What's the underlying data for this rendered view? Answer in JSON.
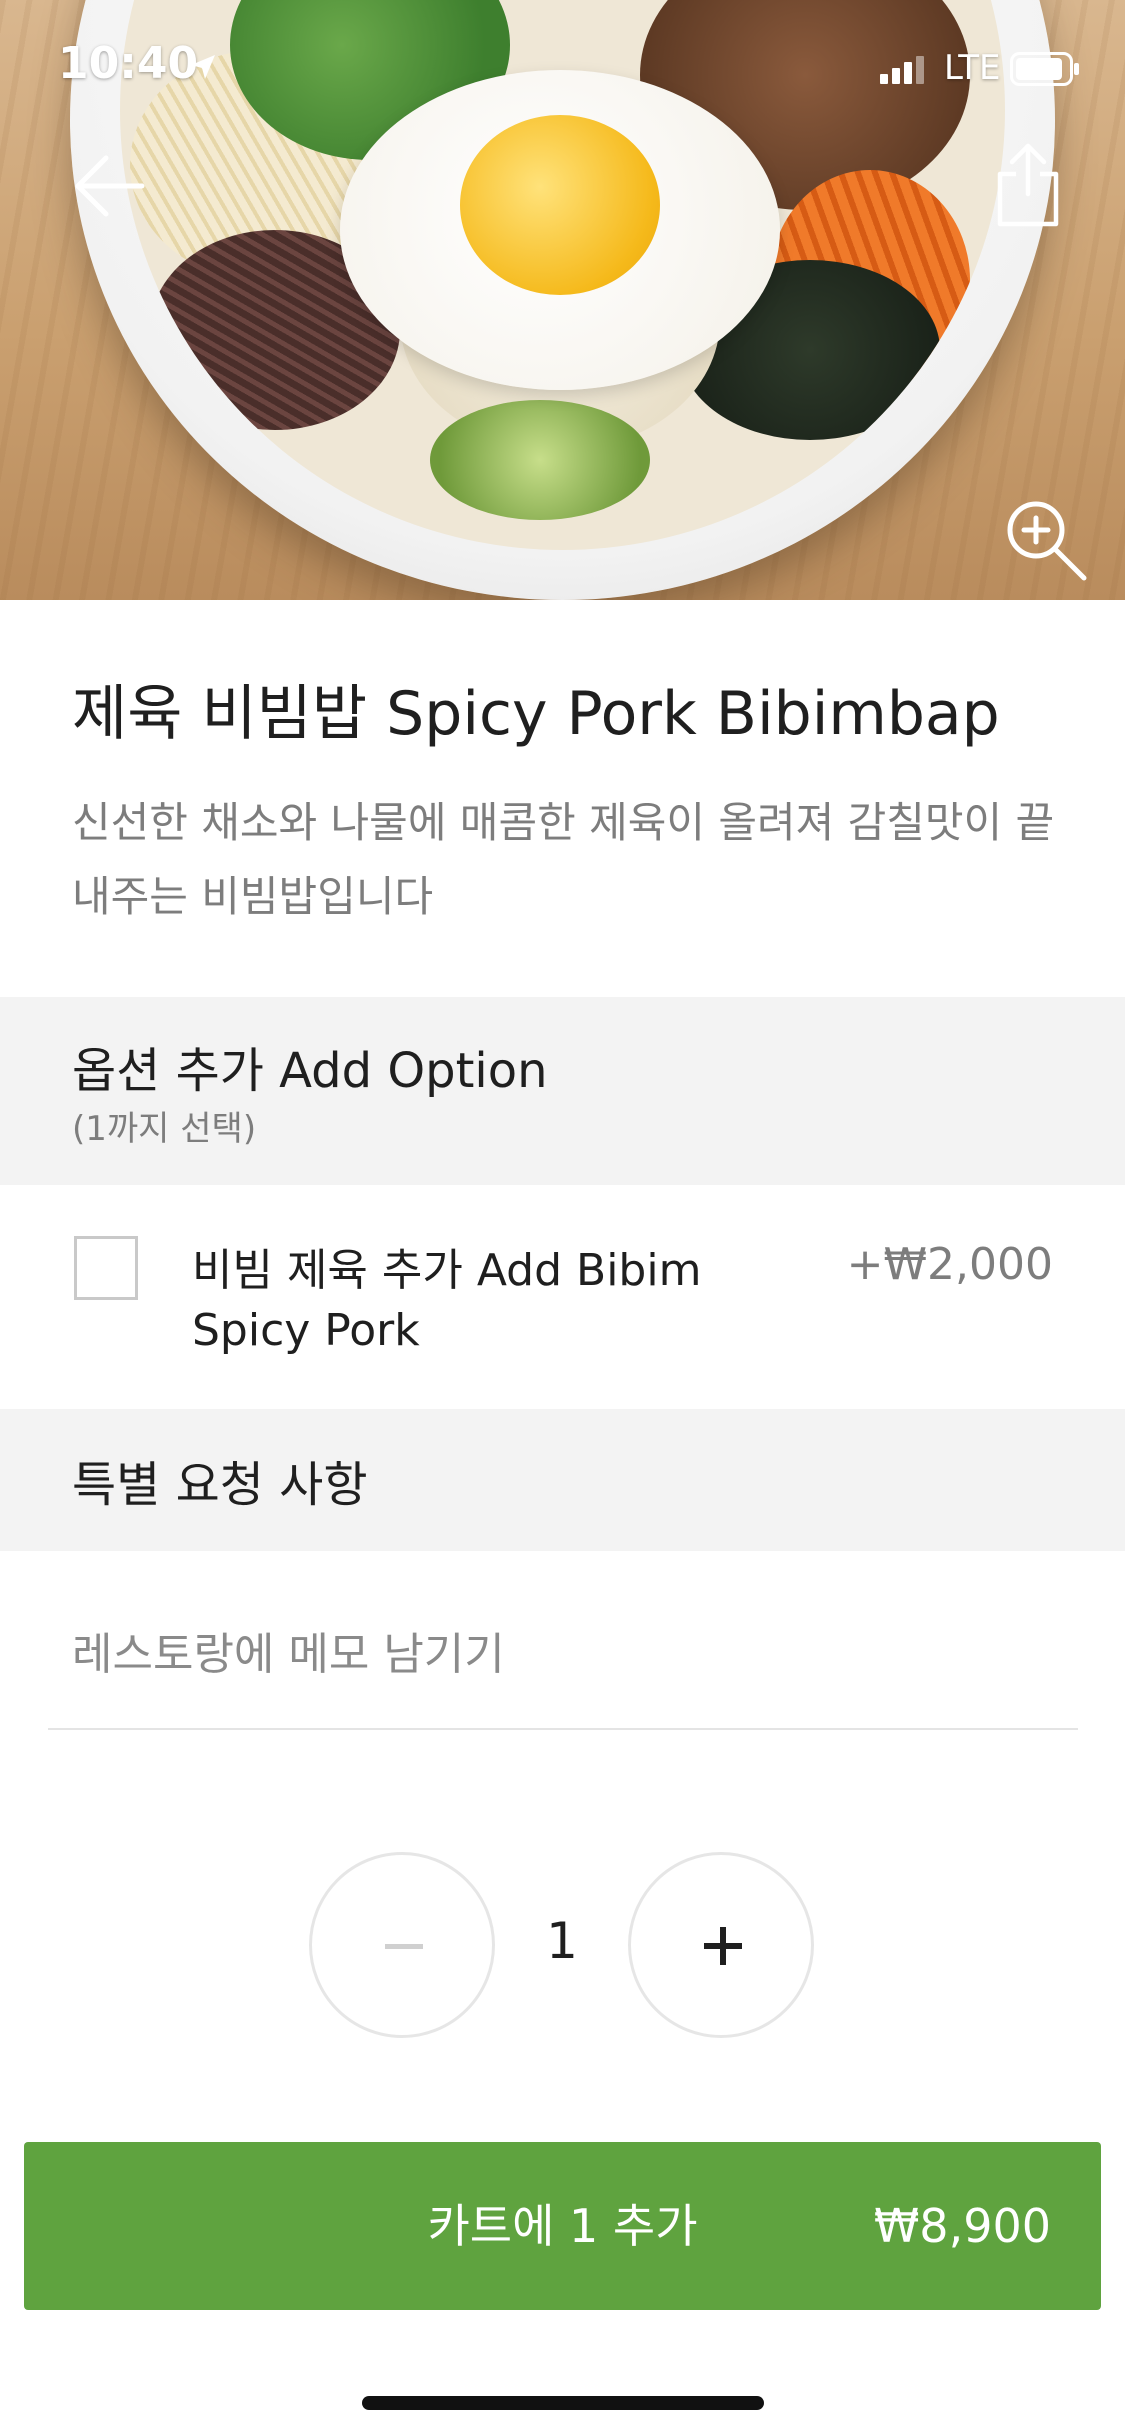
{
  "status_bar": {
    "time": "10:40",
    "network": "LTE",
    "signal_bars": 3
  },
  "hero": {
    "icons": [
      "back-arrow-icon",
      "share-icon",
      "zoom-in-icon"
    ]
  },
  "item": {
    "title": "제육 비빔밥 Spicy Pork Bibimbap",
    "description": "신선한 채소와 나물에 매콤한 제육이 올려져 감칠맛이 끝내주는 비빔밥입니다"
  },
  "options": {
    "title": "옵션 추가 Add Option",
    "subtitle": "(1까지 선택)",
    "items": [
      {
        "label": "비빔 제육 추가 Add Bibim Spicy Pork",
        "price": "+₩2,000",
        "checked": false
      }
    ]
  },
  "special_request": {
    "title": "특별 요청 사항",
    "placeholder": "레스토랑에 메모 남기기",
    "value": ""
  },
  "quantity": {
    "value": "1"
  },
  "cart_button": {
    "label": "카트에 1 추가",
    "total": "₩8,900"
  },
  "colors": {
    "accent": "#5fa33f",
    "muted_text": "#7d7d7d",
    "section_bg": "#f3f3f3"
  }
}
